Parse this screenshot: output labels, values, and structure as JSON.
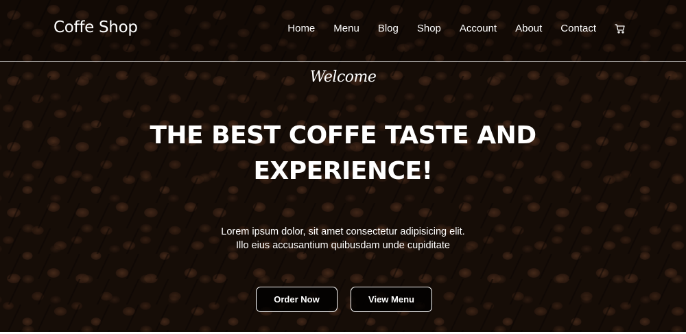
{
  "nav": {
    "brand": "Coffe Shop",
    "links": [
      "Home",
      "Menu",
      "Blog",
      "Shop",
      "Account",
      "About",
      "Contact"
    ],
    "cart_icon": "cart-icon"
  },
  "hero": {
    "welcome": "Welcome",
    "headline_line1": "THE BEST COFFE TASTE AND",
    "headline_line2": "EXPERIENCE!",
    "subtext_line1": "Lorem ipsum dolor, sit amet consectetur adipisicing elit.",
    "subtext_line2": "Illo eius accusantium quibusdam unde cupiditate",
    "buttons": {
      "order": "Order Now",
      "menu": "View Menu"
    }
  },
  "colors": {
    "text": "#ffffff",
    "button_bg": "#000000",
    "background": "#22140c"
  }
}
